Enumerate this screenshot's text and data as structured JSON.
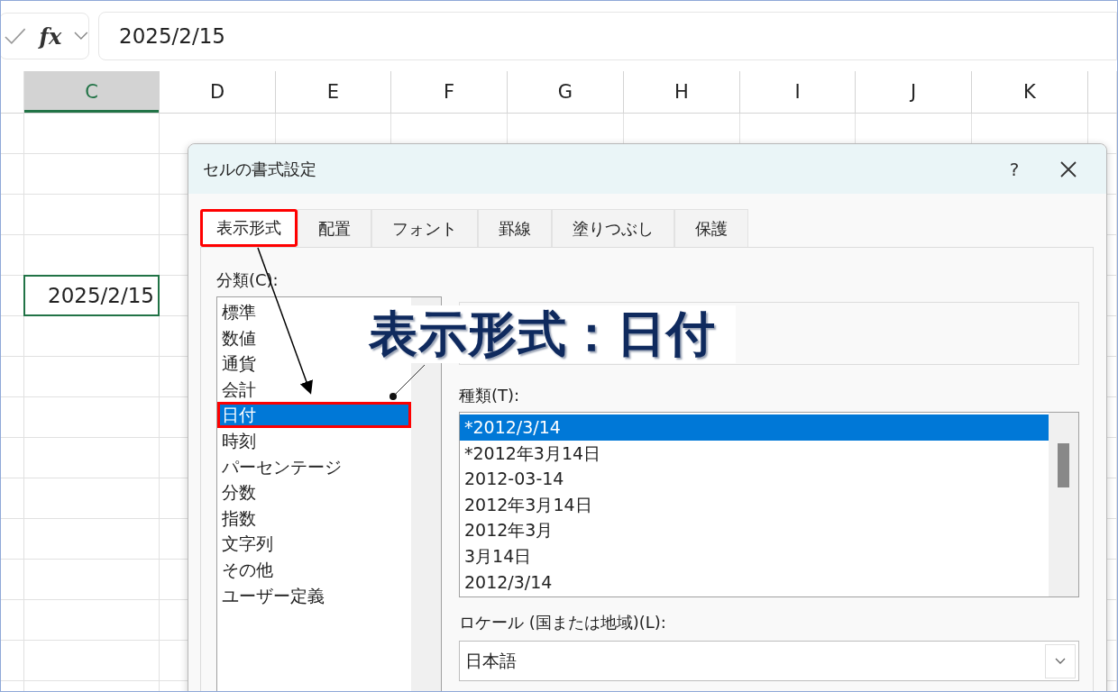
{
  "formula_bar": {
    "fx": "fx",
    "value": "2025/2/15"
  },
  "columns": [
    {
      "label": "C",
      "selected": true
    },
    {
      "label": "D",
      "selected": false
    },
    {
      "label": "E",
      "selected": false
    },
    {
      "label": "F",
      "selected": false
    },
    {
      "label": "G",
      "selected": false
    },
    {
      "label": "H",
      "selected": false
    },
    {
      "label": "I",
      "selected": false
    },
    {
      "label": "J",
      "selected": false
    },
    {
      "label": "K",
      "selected": false
    }
  ],
  "active_cell": {
    "value": "2025/2/15"
  },
  "dialog": {
    "title": "セルの書式設定",
    "help": "?",
    "tabs": [
      {
        "label": "表示形式",
        "selected": true,
        "highlighted": true
      },
      {
        "label": "配置",
        "selected": false,
        "highlighted": false
      },
      {
        "label": "フォント",
        "selected": false,
        "highlighted": false
      },
      {
        "label": "罫線",
        "selected": false,
        "highlighted": false
      },
      {
        "label": "塗りつぶし",
        "selected": false,
        "highlighted": false
      },
      {
        "label": "保護",
        "selected": false,
        "highlighted": false
      }
    ],
    "category_label": "分類(C):",
    "categories": [
      {
        "label": "標準",
        "selected": false,
        "highlighted": false
      },
      {
        "label": "数値",
        "selected": false,
        "highlighted": false
      },
      {
        "label": "通貨",
        "selected": false,
        "highlighted": false
      },
      {
        "label": "会計",
        "selected": false,
        "highlighted": false
      },
      {
        "label": "日付",
        "selected": true,
        "highlighted": true
      },
      {
        "label": "時刻",
        "selected": false,
        "highlighted": false
      },
      {
        "label": "パーセンテージ",
        "selected": false,
        "highlighted": false
      },
      {
        "label": "分数",
        "selected": false,
        "highlighted": false
      },
      {
        "label": "指数",
        "selected": false,
        "highlighted": false
      },
      {
        "label": "文字列",
        "selected": false,
        "highlighted": false
      },
      {
        "label": "その他",
        "selected": false,
        "highlighted": false
      },
      {
        "label": "ユーザー定義",
        "selected": false,
        "highlighted": false
      }
    ],
    "type_label": "種類(T):",
    "types": [
      {
        "label": "*2012/3/14",
        "selected": true
      },
      {
        "label": "*2012年3月14日",
        "selected": false
      },
      {
        "label": "2012-03-14",
        "selected": false
      },
      {
        "label": "2012年3月14日",
        "selected": false
      },
      {
        "label": "2012年3月",
        "selected": false
      },
      {
        "label": "3月14日",
        "selected": false
      },
      {
        "label": "2012/3/14",
        "selected": false
      }
    ],
    "locale_label": "ロケール (国または地域)(L):",
    "locale_value": "日本語"
  },
  "callout": {
    "text": "表示形式：日付"
  }
}
